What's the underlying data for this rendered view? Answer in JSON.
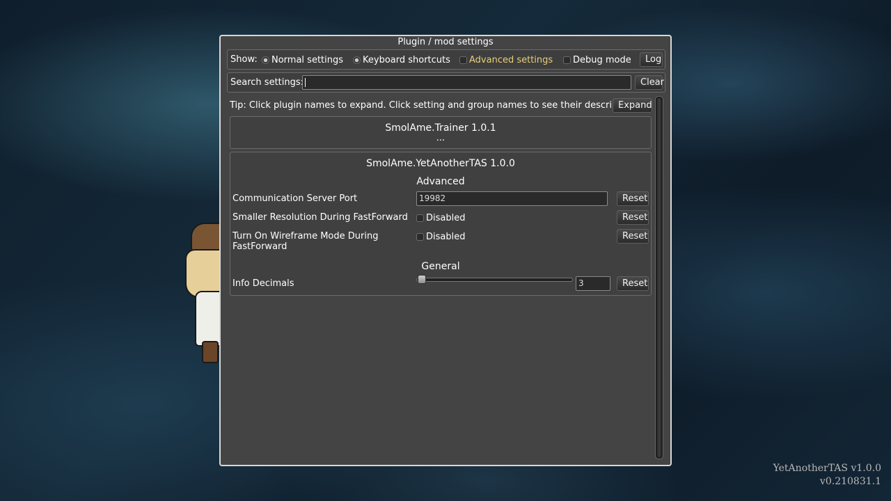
{
  "window": {
    "title": "Plugin / mod settings"
  },
  "show_bar": {
    "label": "Show:",
    "normal": "Normal settings",
    "keyboard": "Keyboard shortcuts",
    "advanced": "Advanced settings",
    "debug": "Debug mode",
    "log_button": "Log",
    "advanced_color": "#e7cf7a"
  },
  "search": {
    "label": "Search settings:",
    "value": "",
    "clear_button": "Clear"
  },
  "tip": {
    "text": "Tip: Click plugin names to expand. Click setting and group names to see their descriptions.",
    "expand_button": "Expand"
  },
  "plugins": [
    {
      "name": "SmolAme.Trainer 1.0.1",
      "collapsed_marker": "..."
    },
    {
      "name": "SmolAme.YetAnotherTAS 1.0.0",
      "sections": [
        {
          "title": "Advanced",
          "settings": [
            {
              "name": "Communication Server Port",
              "value": "19982",
              "reset": "Reset"
            },
            {
              "name": "Smaller Resolution During FastForward",
              "value": "Disabled",
              "reset": "Reset"
            },
            {
              "name_line1": "Turn On Wireframe Mode During",
              "name_line2": "FastForward",
              "value": "Disabled",
              "reset": "Reset"
            }
          ]
        },
        {
          "title": "General",
          "settings": [
            {
              "name": "Info Decimals",
              "value": "3",
              "slider_fraction": 0.03,
              "reset": "Reset"
            }
          ]
        }
      ]
    }
  ],
  "watermark": {
    "line1": "YetAnotherTAS v1.0.0",
    "line2": "v0.210831.1"
  }
}
